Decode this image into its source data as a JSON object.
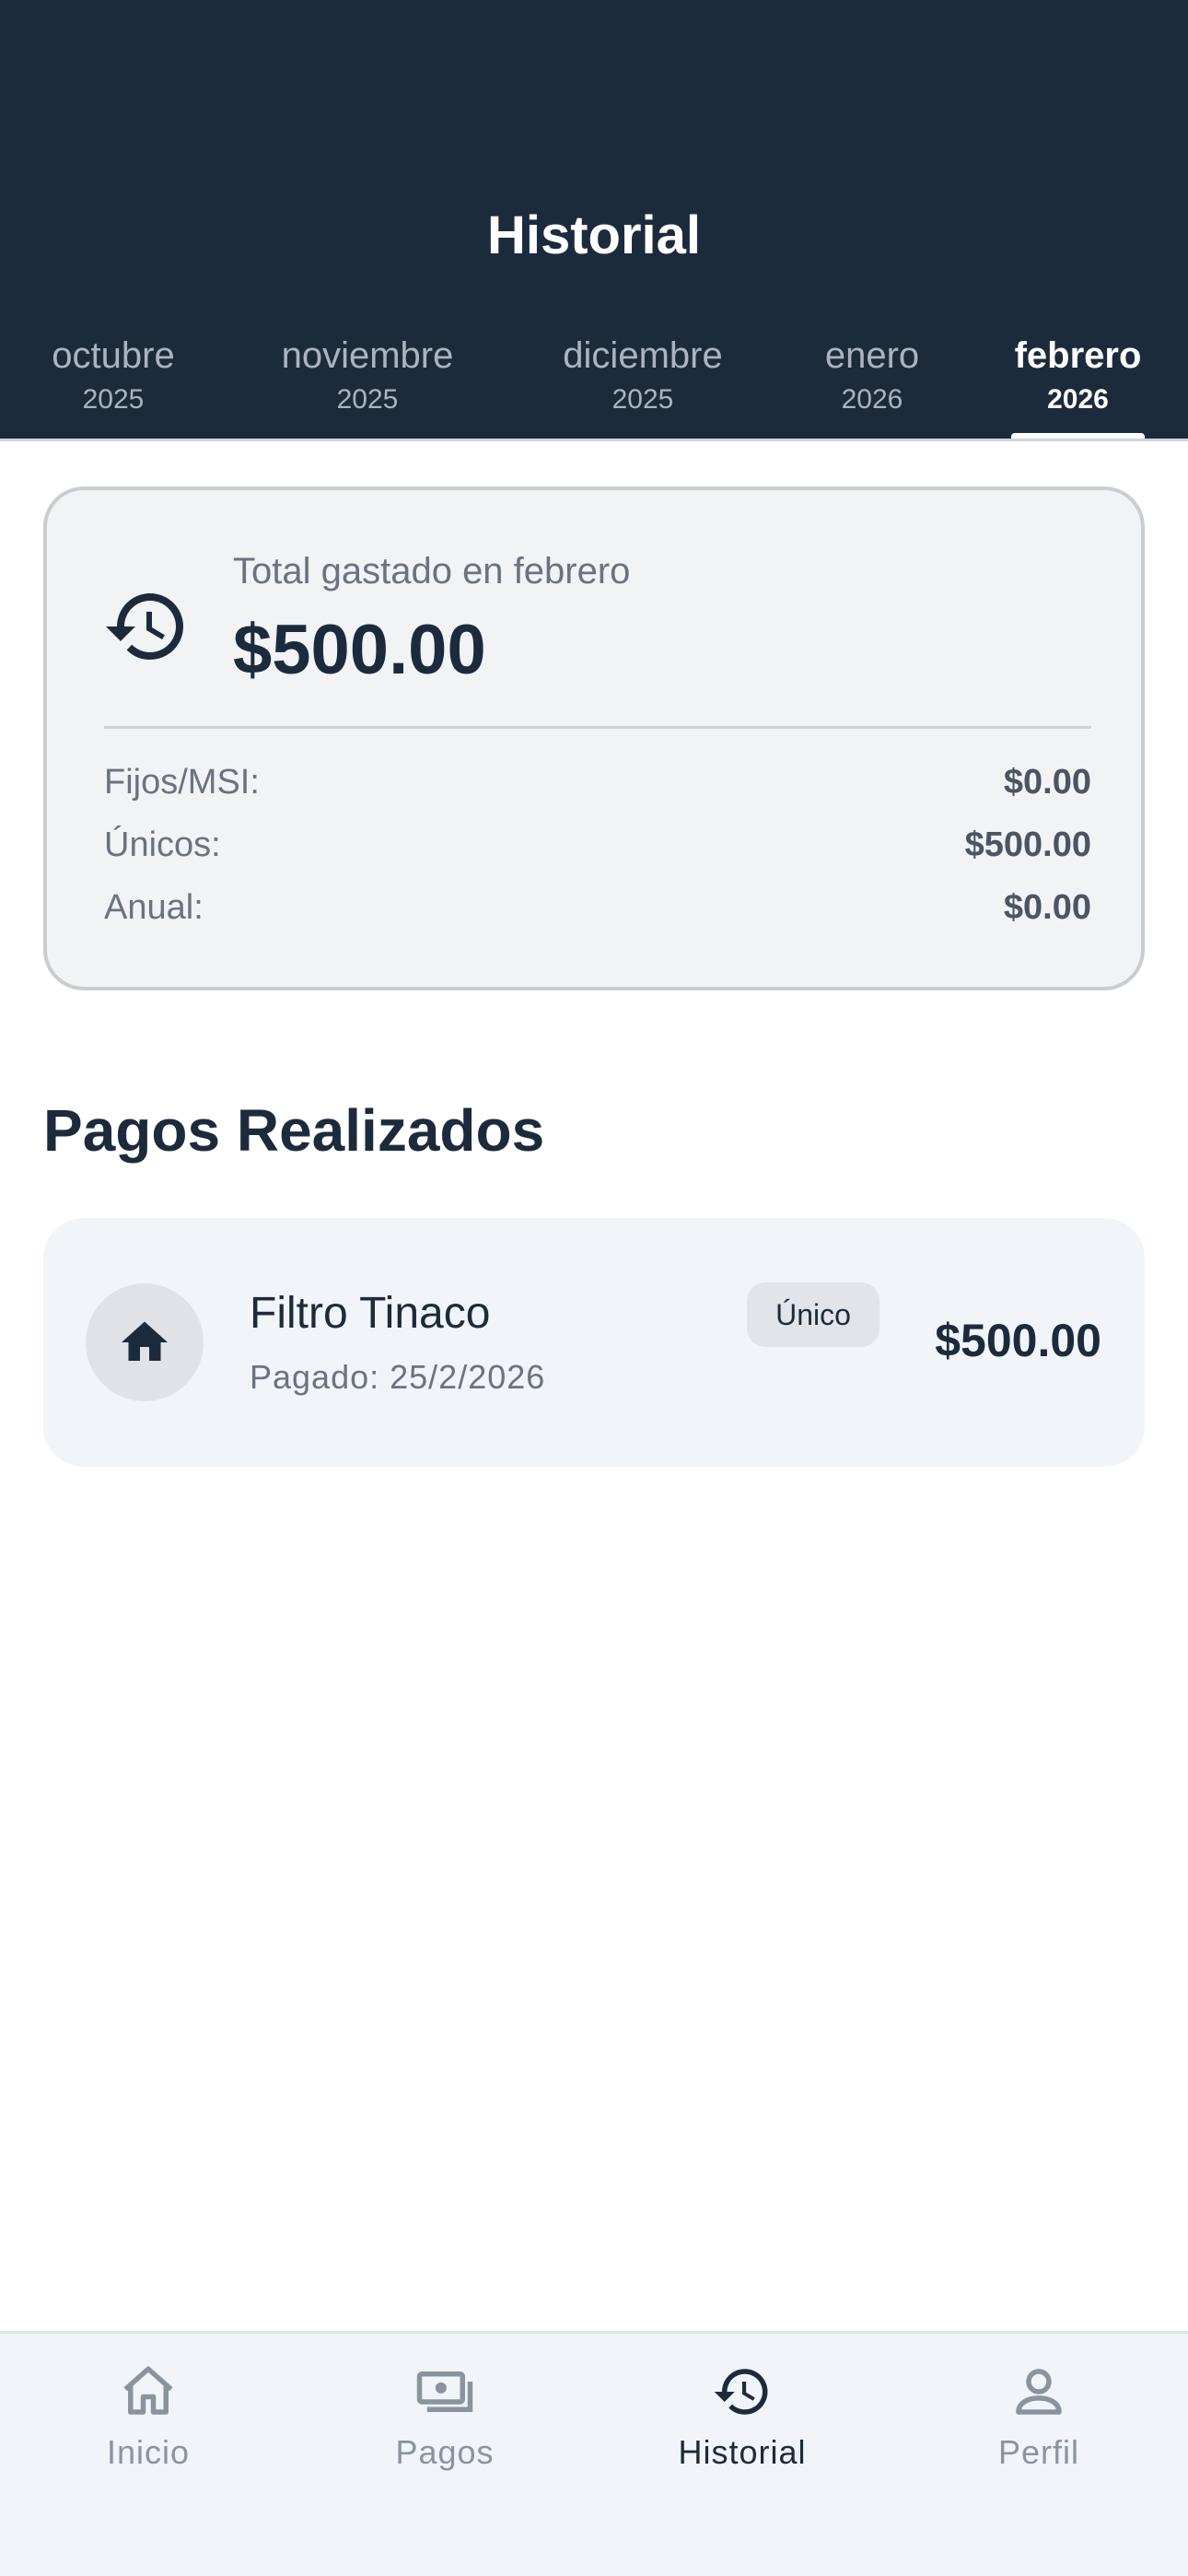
{
  "header": {
    "title": "Historial",
    "months": [
      {
        "name": "octubre",
        "year": "2025"
      },
      {
        "name": "noviembre",
        "year": "2025"
      },
      {
        "name": "diciembre",
        "year": "2025"
      },
      {
        "name": "enero",
        "year": "2026"
      },
      {
        "name": "febrero",
        "year": "2026",
        "active": true
      }
    ]
  },
  "summary": {
    "icon": "history-icon",
    "label": "Total gastado en febrero",
    "total": "$500.00",
    "rows": [
      {
        "label": "Fijos/MSI:",
        "value": "$0.00"
      },
      {
        "label": "Únicos:",
        "value": "$500.00"
      },
      {
        "label": "Anual:",
        "value": "$0.00"
      }
    ]
  },
  "section_title": "Pagos Realizados",
  "payments": [
    {
      "icon": "home-icon",
      "name": "Filtro Tinaco",
      "date": "Pagado: 25/2/2026",
      "badge": "Único",
      "amount": "$500.00"
    }
  ],
  "bottom_nav": [
    {
      "label": "Inicio",
      "icon": "home-outline-icon"
    },
    {
      "label": "Pagos",
      "icon": "cash-icon"
    },
    {
      "label": "Historial",
      "icon": "history-icon",
      "active": true
    },
    {
      "label": "Perfil",
      "icon": "person-icon"
    }
  ],
  "colors": {
    "header_bg": "#1c2b3c",
    "card_bg": "#f2f3f5",
    "text_primary": "#1c2b3c",
    "text_muted": "#6b7280"
  }
}
